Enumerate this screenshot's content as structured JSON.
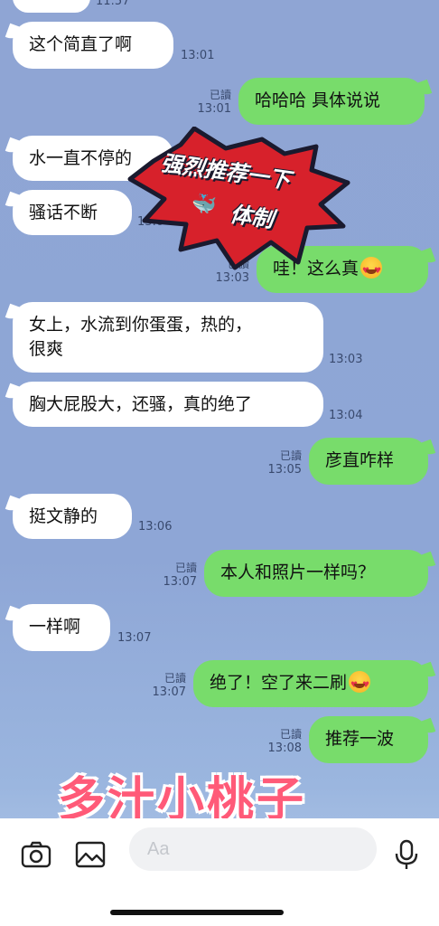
{
  "top_partial_time": "11:57",
  "messages": [
    {
      "dir": "in",
      "text": "这个简直了啊",
      "time": "13:01"
    },
    {
      "dir": "out",
      "text": "哈哈哈 具体说说",
      "read": "已讀",
      "time": "13:01"
    },
    {
      "dir": "in",
      "text": "水一直不停的",
      "time": ""
    },
    {
      "dir": "in",
      "text": "骚话不断",
      "time": "13:0"
    },
    {
      "dir": "out",
      "text": "哇！这么真",
      "read": "已讀",
      "time": "13:03",
      "emoji": "heart-eyes-emoji"
    },
    {
      "dir": "in",
      "text": "女上，水流到你蛋蛋，热的，",
      "text2": "很爽",
      "time": "13:03"
    },
    {
      "dir": "in",
      "text": "胸大屁股大，还骚，真的绝了",
      "time": "13:04"
    },
    {
      "dir": "out",
      "text": "彦直咋样",
      "read": "已讀",
      "time": "13:05"
    },
    {
      "dir": "in",
      "text": "挺文静的",
      "time": "13:06"
    },
    {
      "dir": "out",
      "text": "本人和照片一样吗？",
      "read": "已讀",
      "time": "13:07"
    },
    {
      "dir": "in",
      "text": "一样啊",
      "time": "13:07"
    },
    {
      "dir": "out",
      "text": "绝了！空了来二刷",
      "read": "已讀",
      "time": "13:07",
      "emoji": "smiling-hearts-emoji"
    },
    {
      "dir": "out",
      "text": "推荐一波",
      "read": "已讀",
      "time": "13:08"
    }
  ],
  "sticker": {
    "line1": "强烈推荐一下",
    "line2": "体制",
    "icon": "whale-icon",
    "colors": {
      "burst": "#d7212b",
      "outline": "#1a1a2e"
    }
  },
  "watermark": "多汁小桃子",
  "input_bar": {
    "placeholder": "Aa",
    "icons": [
      "camera-icon",
      "image-icon",
      "emoji-icon",
      "microphone-icon"
    ]
  },
  "colors": {
    "incoming": "#ffffff",
    "outgoing": "#78dc6b",
    "background": "#8fa5d4",
    "watermark": "#ff5a78"
  }
}
